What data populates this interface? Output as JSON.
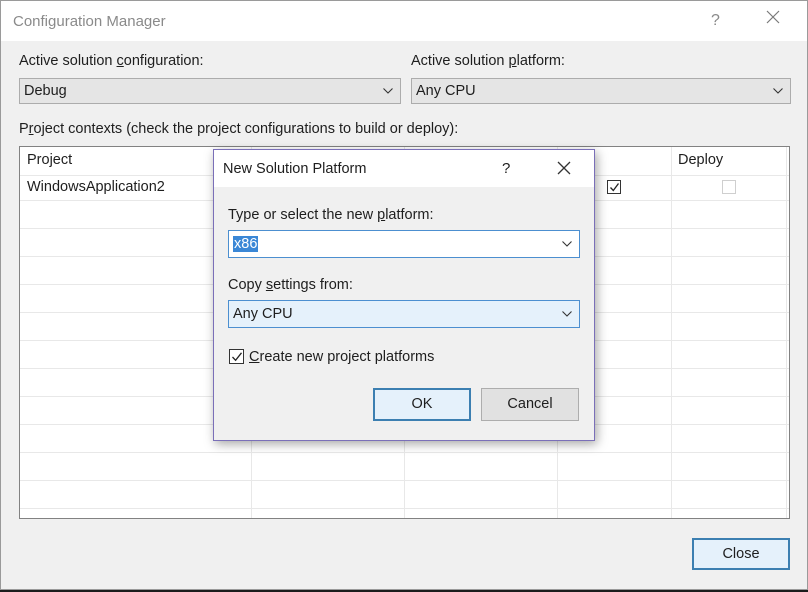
{
  "window": {
    "title": "Configuration Manager",
    "help_label": "?"
  },
  "config": {
    "label_pre": "Active solution ",
    "label_key": "c",
    "label_post": "onfiguration:",
    "value": "Debug"
  },
  "platform": {
    "label_pre": "Active solution ",
    "label_key": "p",
    "label_post": "latform:",
    "value": "Any CPU"
  },
  "contexts": {
    "label_pre": "P",
    "label_key": "r",
    "label_post": "oject contexts (check the project configurations to build or deploy):"
  },
  "grid": {
    "headers": {
      "project": "Project",
      "deploy": "Deploy"
    },
    "rows": [
      {
        "project": "WindowsApplication2",
        "build": true,
        "deploy": false
      }
    ]
  },
  "close_button": {
    "label": "Close"
  },
  "dialog": {
    "title": "New Solution Platform",
    "help_label": "?",
    "type_label_pre": "Type or select the new ",
    "type_label_key": "p",
    "type_label_post": "latform:",
    "platform_value": "x86",
    "copy_label_pre": "Copy ",
    "copy_label_key": "s",
    "copy_label_post": "ettings from:",
    "copy_value": "Any CPU",
    "create_checked": true,
    "create_key": "C",
    "create_label": "reate new project platforms",
    "ok_label": "OK",
    "cancel_label": "Cancel"
  },
  "colors": {
    "accent": "#3c7fb1",
    "selection": "#3a87d6",
    "dialog_border": "#7a6fb8"
  }
}
